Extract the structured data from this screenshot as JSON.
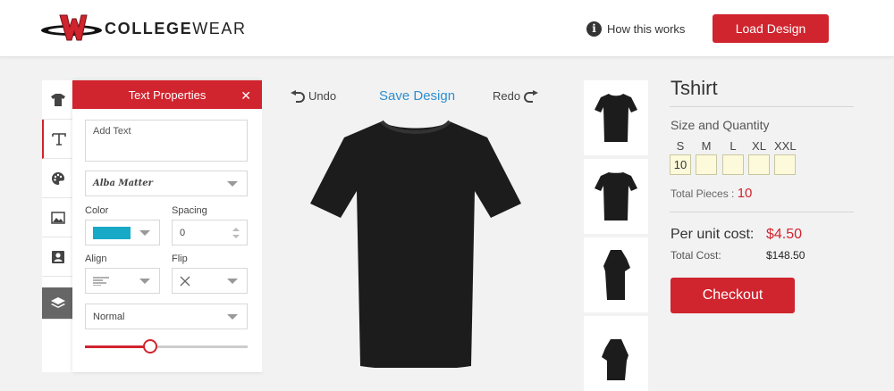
{
  "header": {
    "brand_prefix": "COLLEGE",
    "brand_suffix": "WEAR",
    "how_label": "How this works",
    "load_label": "Load Design"
  },
  "rail": {
    "items": [
      "tshirt-icon",
      "text-icon",
      "palette-icon",
      "image-icon",
      "contact-card-icon",
      "layers-icon"
    ]
  },
  "text_panel": {
    "title": "Text Properties",
    "text_placeholder": "Add Text",
    "font_value": "Alba Matter",
    "color_label": "Color",
    "color_value": "#17a9c6",
    "spacing_label": "Spacing",
    "spacing_value": "0",
    "align_label": "Align",
    "flip_label": "Flip",
    "style_value": "Normal",
    "slider_level": 0.4
  },
  "canvas": {
    "undo_label": "Undo",
    "save_label": "Save Design",
    "redo_label": "Redo",
    "shirt_color": "#1c1c1c"
  },
  "summary": {
    "product": "Tshirt",
    "size_qty_label": "Size and Quantity",
    "sizes": [
      "S",
      "M",
      "L",
      "XL",
      "XXL"
    ],
    "quantities": [
      "10",
      "",
      "",
      "",
      ""
    ],
    "total_pieces_label": "Total Pieces : ",
    "total_pieces_value": "10",
    "per_unit_label": "Per unit cost:",
    "per_unit_value": "$4.50",
    "total_cost_label": "Total Cost:",
    "total_cost_value": "$148.50",
    "checkout_label": "Checkout"
  },
  "colors": {
    "accent": "#d0242e",
    "link": "#2e8fcf"
  }
}
